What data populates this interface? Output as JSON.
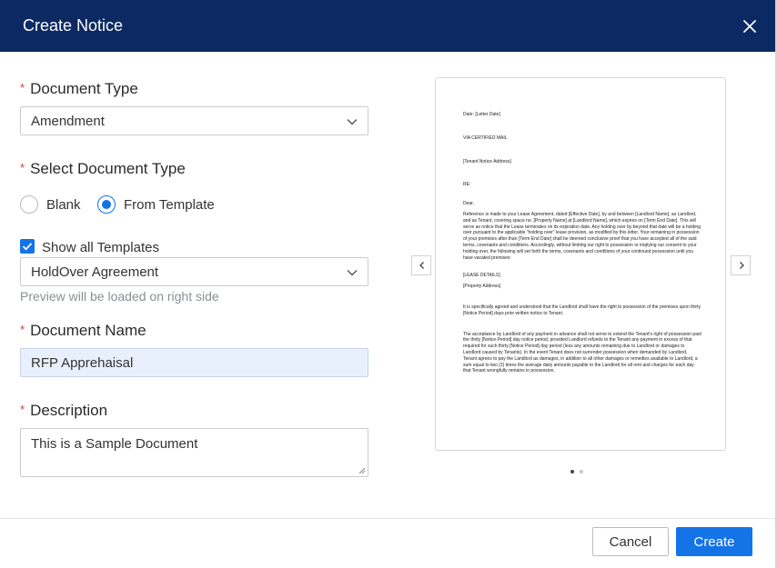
{
  "header": {
    "title": "Create Notice",
    "close_icon": "close-icon"
  },
  "form": {
    "document_type": {
      "label": "Document Type",
      "value": "Amendment"
    },
    "select_document_type": {
      "label": "Select Document Type",
      "options": [
        {
          "label": "Blank",
          "checked": false
        },
        {
          "label": "From Template",
          "checked": true
        }
      ]
    },
    "show_all_templates": {
      "label": "Show all Templates",
      "checked": true
    },
    "template": {
      "value": "HoldOver Agreement",
      "hint": "Preview will be loaded on right side"
    },
    "document_name": {
      "label": "Document Name",
      "value": "RFP Apprehaisal"
    },
    "description": {
      "label": "Description",
      "value": "This is a Sample Document"
    },
    "required_mark": "*"
  },
  "preview": {
    "page": 1,
    "total_pages": 2,
    "lines": {
      "date": "Date: [Letter Date]",
      "via": "VIA CERTIFIED MAIL",
      "address": "[Tenant Notice Address]",
      "re": "RE:",
      "dear": "Dear,",
      "para1": "Reference is made to your Lease Agreement, dated [Effective Date], by and between [Landlord Name], as Landlord, and as Tenant, covering space no. [Property Name] at [Landlord Name], which expires on [Term End Date]. This will serve as notice that the Lease terminates on its expiration date. Any holding over by beyond that date will be a holding over pursuant to the applicable \"holding over\" lease provision, as modified by this letter. Your remaining in possession of your premises after than [Term End Date] shall be deemed conclusive proof that you have accepted all of the said terms, covenants and conditions. Accordingly, without limiting our right to possession or implying our consent to your holding over, the following will set forth the terms, covenants and conditions of your continued possession until you have vacated premises:",
      "lease_details": "[LEASE DETAILS]",
      "property_address": "[Property Address]",
      "para2": "It is specifically agreed and understood that the Landlord shall have the right to possession of the premises upon thirty [Notice Period] days prior written notice to Tenant.",
      "para3": "The acceptance by Landlord of any payment in advance shall not serve to extend the Tenant's right of possession past the thirty [Notice Period] day notice period, provided Landlord refunds to the Tenant any payment in excess of that required for such thirty [Notice Period] day period (less any amounts remaining due to Landlord or damages to Landlord caused by Tenants). In the event Tenant does not surrender possession when demanded by Landlord, Tenant agrees to pay the Landlord as damages, in addition to all other damages or remedies available to Landlord, a sum equal to two (2) times the average daily amounts payable to the Landlord for all rent and charges for each day that Tenant wrongfully remains in possession."
    }
  },
  "footer": {
    "cancel_label": "Cancel",
    "create_label": "Create"
  },
  "colors": {
    "header": "#0b2a63",
    "primary": "#1473e6",
    "required": "#d63b3b"
  }
}
